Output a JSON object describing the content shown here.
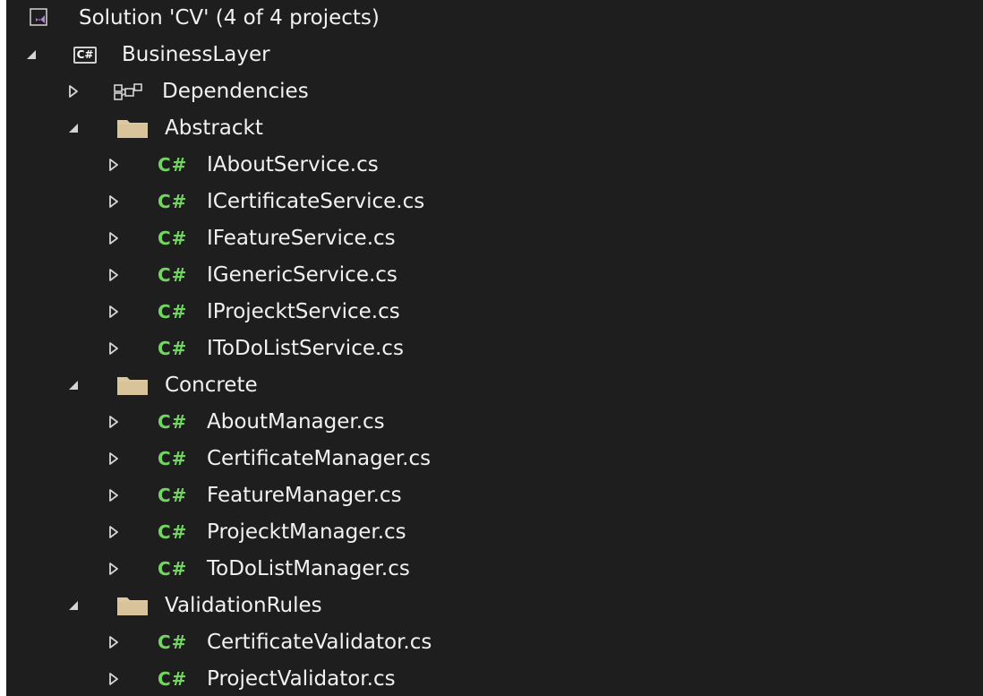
{
  "theme": {
    "background": "#1e1e1e",
    "text": "#f1f1f1",
    "csharp_green": "#72d461",
    "folder_color": "#dcc9a1",
    "caret_color": "#d4d4d4",
    "solution_icon_color": "#b180d7"
  },
  "solution": {
    "label": "Solution 'CV' (4 of 4 projects)",
    "icon": "solution-icon"
  },
  "project": {
    "label": "BusinessLayer",
    "icon_text": "C#",
    "icon": "csharp-project-icon",
    "expanded": true
  },
  "dependencies": {
    "label": "Dependencies",
    "icon": "dependencies-icon",
    "expanded": false
  },
  "csharp_file_icon_text": "C#",
  "folders": [
    {
      "label": "Abstrackt",
      "expanded": true,
      "files": [
        "IAboutService.cs",
        "ICertificateService.cs",
        "IFeatureService.cs",
        "IGenericService.cs",
        "IProjecktService.cs",
        "IToDoListService.cs"
      ]
    },
    {
      "label": "Concrete",
      "expanded": true,
      "files": [
        "AboutManager.cs",
        "CertificateManager.cs",
        "FeatureManager.cs",
        "ProjecktManager.cs",
        "ToDoListManager.cs"
      ]
    },
    {
      "label": "ValidationRules",
      "expanded": true,
      "files": [
        "CertificateValidator.cs",
        "ProjectValidator.cs"
      ]
    }
  ]
}
